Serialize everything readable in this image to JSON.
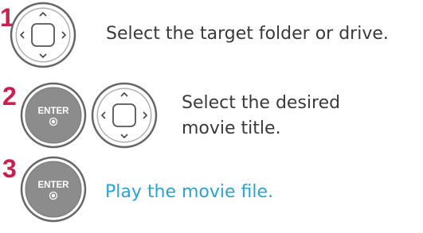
{
  "colors": {
    "step_number": "#c8204f",
    "text": "#3a3a3a",
    "text_highlight": "#2aa3d6",
    "button_face": "#8c8c8c",
    "button_ring": "#666666"
  },
  "steps": [
    {
      "number": "1",
      "buttons": [
        "dpad-icon"
      ],
      "text": "Select the target folder or drive."
    },
    {
      "number": "2",
      "buttons": [
        "enter-button",
        "dpad-icon"
      ],
      "text_line1": "Select the desired",
      "text_line2": "movie title."
    },
    {
      "number": "3",
      "buttons": [
        "enter-button"
      ],
      "text": "Play the movie file."
    }
  ],
  "enter_label": "ENTER"
}
